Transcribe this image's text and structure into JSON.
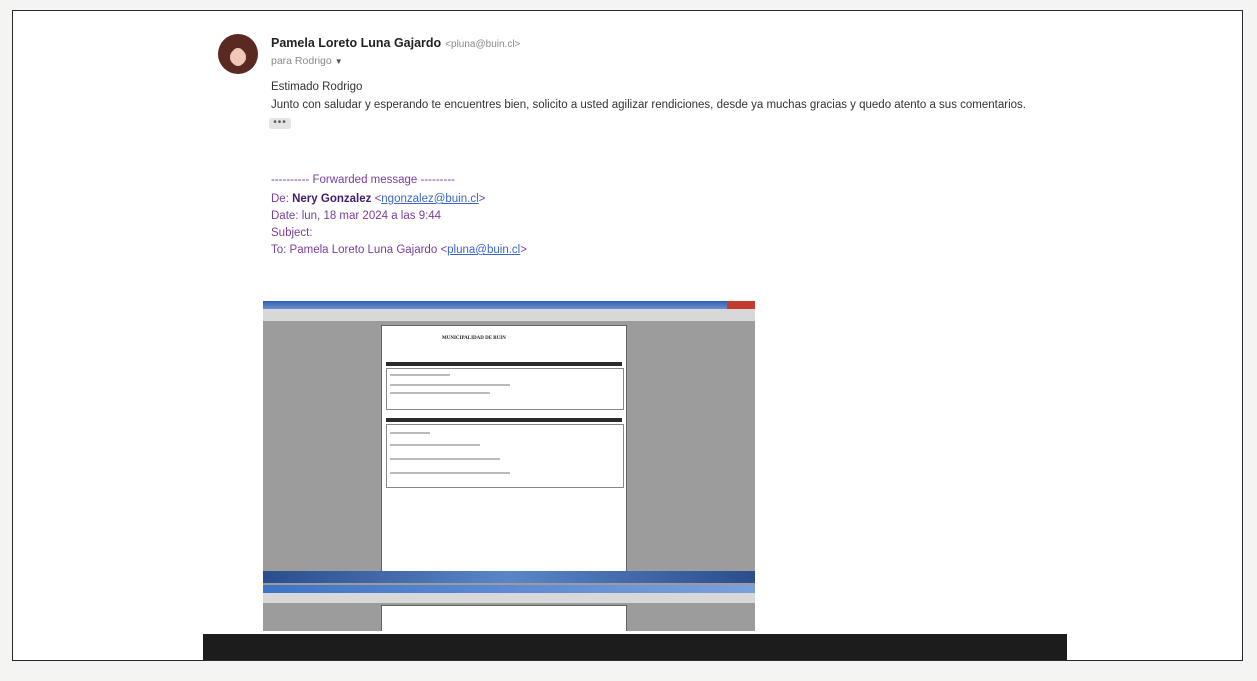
{
  "email": {
    "sender_name": "Pamela Loreto Luna Gajardo",
    "sender_email": "<pluna@buin.cl>",
    "recipient_label": "para Rodrigo",
    "greeting": "Estimado Rodrigo",
    "body": "Junto con saludar y esperando te encuentres bien, solicito a usted agilizar rendiciones, desde ya muchas gracias y quedo atento a sus comentarios.",
    "more_dots": "•••"
  },
  "forwarded": {
    "separator": "---------- Forwarded message ---------",
    "from_label": "De:",
    "from_name": "Nery Gonzalez",
    "from_email_open": "<",
    "from_email": "ngonzalez@buin.cl",
    "from_email_close": ">",
    "date_label": "Date:",
    "date_value": "lun, 18 mar 2024 a las 9:44",
    "subject_label": "Subject:",
    "to_label": "To:",
    "to_name": "Pamela Loreto Luna Gajardo",
    "to_email_open": "<",
    "to_email": "pluna@buin.cl",
    "to_email_close": ">"
  },
  "attachment": {
    "doc_title": "MUNICIPALIDAD DE BUIN"
  },
  "icons": {
    "caret": "chevron-down-icon"
  }
}
